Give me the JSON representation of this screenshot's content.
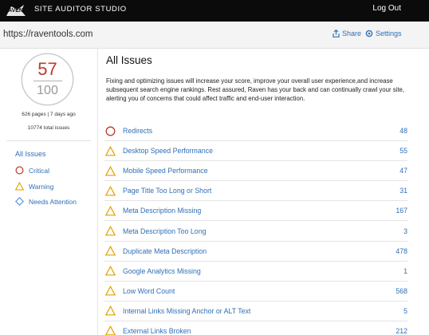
{
  "header": {
    "logo_text": "RAVEN",
    "app_title": "SITE AUDITOR STUDIO",
    "logout": "Log Out"
  },
  "urlbar": {
    "site_url": "https://raventools.com",
    "share": "Share",
    "settings": "Settings"
  },
  "colors": {
    "accent": "#2f6fb6",
    "critical": "#c0392b",
    "warning": "#e2a200",
    "needs_attention": "#5b8fd6"
  },
  "score": {
    "value": "57",
    "max": "100",
    "crawl_info": "626 pages | 7 days ago",
    "total_issues": "10774 total issues"
  },
  "filters": {
    "all": "All Issues",
    "items": [
      {
        "label": "Critical",
        "icon": "critical-circle-icon"
      },
      {
        "label": "Warning",
        "icon": "warning-triangle-icon"
      },
      {
        "label": "Needs Attention",
        "icon": "needs-attention-diamond-icon"
      }
    ]
  },
  "main": {
    "heading": "All Issues",
    "intro": "Fixing and optimizing issues will increase your score, improve your overall user experience,and increase subsequent search engine rankings. Rest assured, Raven has your back and can continually crawl your site, alerting you of concerns that could affect traffic and end-user interaction.",
    "issues": [
      {
        "name": "Redirects",
        "count": "48",
        "severity": "critical"
      },
      {
        "name": "Desktop Speed Performance",
        "count": "55",
        "severity": "warning"
      },
      {
        "name": "Mobile Speed Performance",
        "count": "47",
        "severity": "warning"
      },
      {
        "name": "Page Title Too Long or Short",
        "count": "31",
        "severity": "warning"
      },
      {
        "name": "Meta Description Missing",
        "count": "167",
        "severity": "warning"
      },
      {
        "name": "Meta Description Too Long",
        "count": "3",
        "severity": "warning"
      },
      {
        "name": "Duplicate Meta Description",
        "count": "478",
        "severity": "warning"
      },
      {
        "name": "Google Analytics Missing",
        "count": "1",
        "severity": "warning"
      },
      {
        "name": "Low Word Count",
        "count": "568",
        "severity": "warning"
      },
      {
        "name": "Internal Links Missing Anchor or ALT Text",
        "count": "5",
        "severity": "warning"
      },
      {
        "name": "External Links Broken",
        "count": "212",
        "severity": "warning"
      }
    ]
  }
}
